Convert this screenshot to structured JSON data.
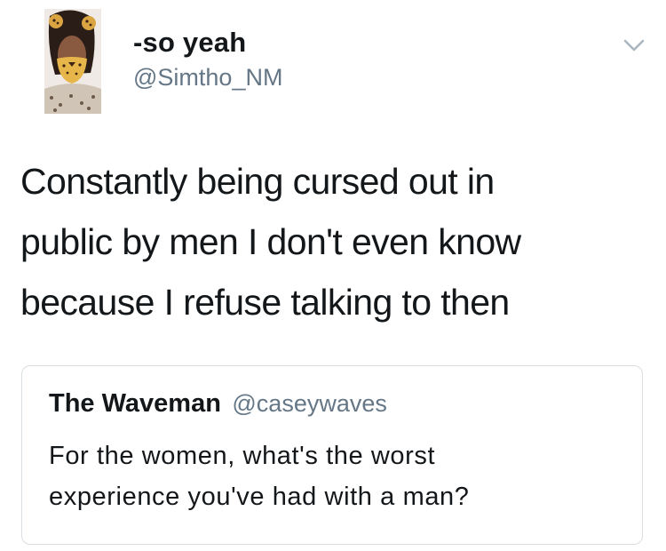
{
  "tweet": {
    "author": {
      "display_name": "-so yeah",
      "handle": "@Simtho_NM",
      "avatar_icon": "profile-photo-with-leopard-filter"
    },
    "menu_icon": "chevron-down-icon",
    "text_lines": [
      "Constantly being cursed out in",
      "public by men I don't even know",
      "because I refuse talking to then"
    ]
  },
  "quoted_tweet": {
    "display_name": "The Waveman",
    "handle": "@caseywaves",
    "text_lines": [
      "For the women, what's the worst",
      "experience you've had with a man?"
    ]
  },
  "colors": {
    "primary_text": "#14171a",
    "secondary_text": "#657786",
    "border": "#d9dee2",
    "background": "#ffffff"
  }
}
